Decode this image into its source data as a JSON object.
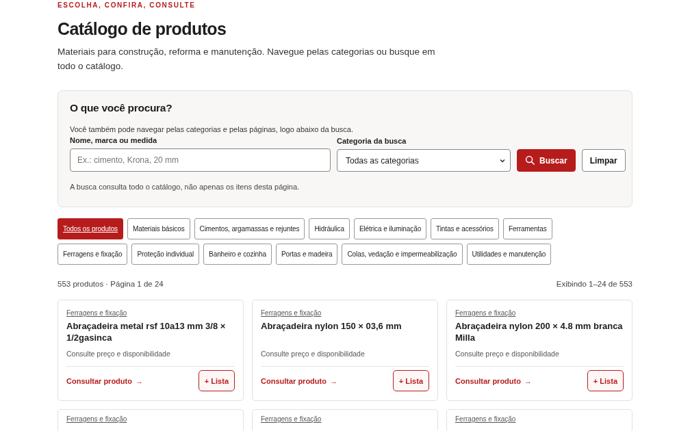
{
  "header": {
    "eyebrow": "ESCOLHA, CONFIRA, CONSULTE",
    "title": "Catálogo de produtos",
    "description": "Materiais para construção, reforma e manutenção. Navegue pelas categorias ou busque em todo o catálogo."
  },
  "search": {
    "title": "O que você procura?",
    "hint": "Você também pode navegar pelas categorias e pelas páginas, logo abaixo da busca.",
    "query_label": "Nome, marca ou medida",
    "placeholder": "Ex.: cimento, Krona, 20 mm",
    "category_label": "Categoria da busca",
    "category_value": "Todas as categorias",
    "search_button": "Buscar",
    "clear_button": "Limpar",
    "note": "A busca consulta todo o catálogo, não apenas os itens desta página."
  },
  "categories": [
    {
      "label": "Todos os produtos",
      "selected": true
    },
    {
      "label": "Materiais básicos",
      "selected": false
    },
    {
      "label": "Cimentos, argamassas e rejuntes",
      "selected": false
    },
    {
      "label": "Hidráulica",
      "selected": false
    },
    {
      "label": "Elétrica e iluminação",
      "selected": false
    },
    {
      "label": "Tintas e acessórios",
      "selected": false
    },
    {
      "label": "Ferramentas",
      "selected": false
    },
    {
      "label": "Ferragens e fixação",
      "selected": false
    },
    {
      "label": "Proteção individual",
      "selected": false
    },
    {
      "label": "Banheiro e cozinha",
      "selected": false
    },
    {
      "label": "Portas e madeira",
      "selected": false
    },
    {
      "label": "Colas, vedação e impermeabilização",
      "selected": false
    },
    {
      "label": "Utilidades e manutenção",
      "selected": false
    }
  ],
  "results": {
    "count": "553 produtos · Página 1 de 24",
    "range": "Exibindo 1–24 de 553"
  },
  "products": [
    {
      "category": "Ferragens e fixação",
      "name": "Abraçadeira metal rsf 10a13 mm 3/8 × 1/2gasinca",
      "note": "Consulte preço e disponibilidade",
      "link": "Consultar produto",
      "arrow": "→",
      "button": "+ Lista"
    },
    {
      "category": "Ferragens e fixação",
      "name": "Abraçadeira nylon 150 × 03,6 mm",
      "note": "Consulte preço e disponibilidade",
      "link": "Consultar produto",
      "arrow": "→",
      "button": "+ Lista"
    },
    {
      "category": "Ferragens e fixação",
      "name": "Abraçadeira nylon 200 × 4.8 mm branca Milla",
      "note": "Consulte preço e disponibilidade",
      "link": "Consultar produto",
      "arrow": "→",
      "button": "+ Lista"
    },
    {
      "category": "Ferragens e fixação"
    },
    {
      "category": "Ferragens e fixação"
    },
    {
      "category": "Ferragens e fixação"
    }
  ]
}
